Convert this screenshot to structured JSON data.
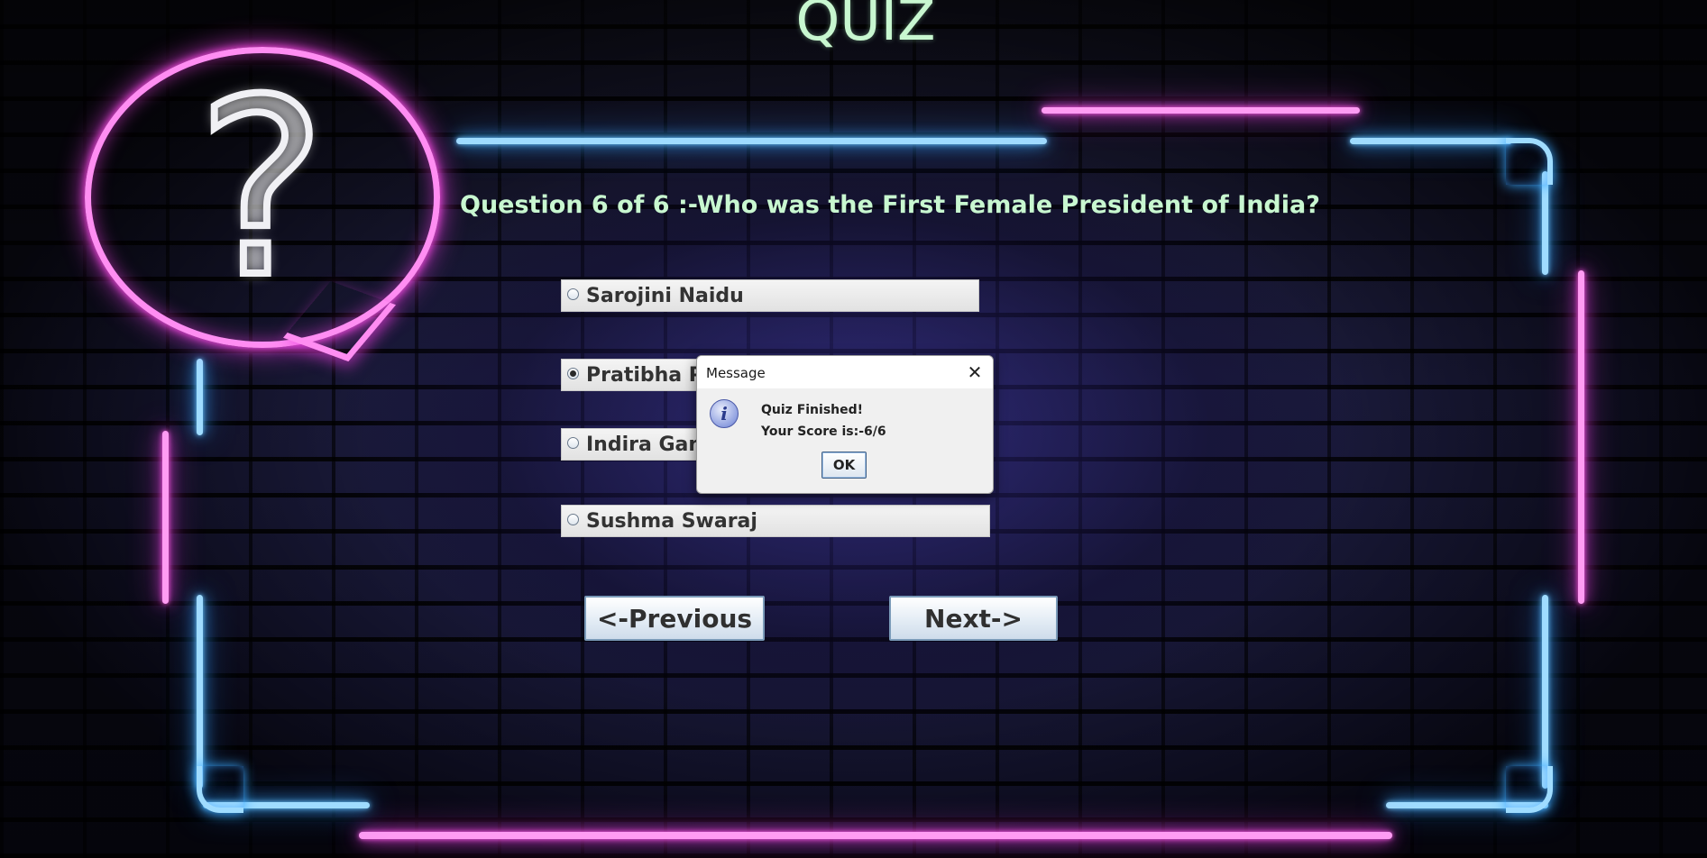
{
  "header": {
    "title": "QUIZ"
  },
  "question": {
    "text": "Question 6 of 6 :-Who was the First Female President of India?"
  },
  "options": [
    {
      "label": "Sarojini Naidu",
      "selected": false
    },
    {
      "label": "Pratibha Patil",
      "selected": true
    },
    {
      "label": "Indira Gandhi",
      "selected": false
    },
    {
      "label": "Sushma Swaraj",
      "selected": false
    }
  ],
  "navigation": {
    "previous_label": "<-Previous",
    "next_label": "Next->"
  },
  "dialog": {
    "title": "Message",
    "close_icon": "close-icon",
    "icon": "information-icon",
    "line1": "Quiz Finished!",
    "line2": "Your Score is:-6/6",
    "ok_label": "OK"
  },
  "colors": {
    "title_text": "#c8f7d0",
    "neon_blue": "#3aa8ff",
    "neon_pink": "#e63fe0"
  }
}
